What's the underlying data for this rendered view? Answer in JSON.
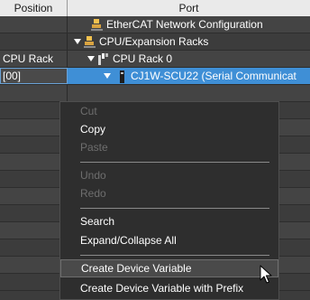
{
  "header": {
    "position": "Position",
    "port": "Port"
  },
  "rows": [
    {
      "position": "",
      "port": "EtherCAT Network Configuration",
      "icon": "ethercat-network-icon"
    },
    {
      "position": "",
      "port": "CPU/Expansion Racks",
      "icon": "cpu-expansion-racks-icon",
      "expanded": true
    },
    {
      "position": "CPU Rack",
      "port": "CPU Rack 0",
      "icon": "cpu-rack-icon",
      "expanded": true
    },
    {
      "position": "[00]",
      "port": "CJ1W-SCU22 (Serial Communicat",
      "icon": "unit-module-icon",
      "expanded": true,
      "selected": true
    }
  ],
  "menu": {
    "items": [
      {
        "label": "Cut",
        "enabled": false
      },
      {
        "label": "Copy",
        "enabled": true
      },
      {
        "label": "Paste",
        "enabled": false
      },
      {
        "label": "Undo",
        "enabled": false
      },
      {
        "label": "Redo",
        "enabled": false
      },
      {
        "label": "Search",
        "enabled": true
      },
      {
        "label": "Expand/Collapse All",
        "enabled": true
      },
      {
        "label": "Create Device Variable",
        "enabled": true,
        "hovered": true
      },
      {
        "label": "Create Device Variable with Prefix",
        "enabled": true
      }
    ]
  },
  "colors": {
    "background": "#3c3c3c",
    "selection": "#3f8fd6",
    "header_bg": "#eaeaea",
    "menu_bg": "#2e2e2e",
    "disabled_text": "#6e6e6e"
  }
}
